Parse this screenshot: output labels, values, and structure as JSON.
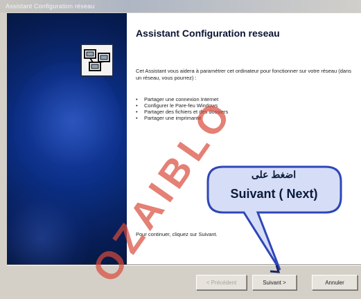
{
  "window": {
    "title": "Assistant Configuration réseau"
  },
  "wizard": {
    "heading": "Assistant Configuration reseau",
    "intro": "Cet Assistant vous aidera à paramétrer cet ordinateur pour fonctionner sur votre réseau (dans un réseau, vous pourrez) :",
    "bullets": [
      "Partager une connexion Internet",
      "Configurer le Pare-feu Windows",
      "Partager des fichiers et des dossiers",
      "Partager une imprimante"
    ],
    "continue_text": "Pour continuer, cliquez sur Suivant."
  },
  "buttons": {
    "back": "< Précédent",
    "next": "Suivant >",
    "cancel": "Annuler"
  },
  "callout": {
    "arabic": "اضغط على",
    "label": "Suivant ( Next)"
  },
  "watermark": {
    "text": "OZAIBLO"
  },
  "colors": {
    "left_panel": "#0b2f86",
    "callout_fill": "#d6ddf6",
    "callout_border": "#2e46b8",
    "arrow": "#1c2560",
    "watermark": "#d94a3a"
  },
  "icons": {
    "wizard_icon": "network-computers-icon"
  }
}
